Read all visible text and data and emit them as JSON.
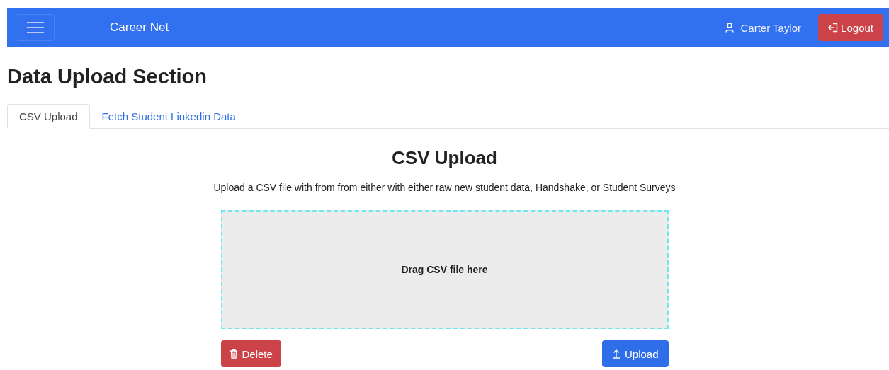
{
  "navbar": {
    "brand": "Career Net",
    "user": "Carter Taylor",
    "logout": "Logout"
  },
  "heading": "Data Upload Section",
  "tabs": [
    {
      "label": "CSV Upload",
      "selected": true
    },
    {
      "label": "Fetch Student Linkedin Data",
      "selected": false
    }
  ],
  "panel": {
    "title": "CSV Upload",
    "description": "Upload a CSV file with from from either with either raw new student data, Handshake, or Student Surveys",
    "dropzone": "Drag CSV file here",
    "delete": "Delete",
    "upload": "Upload"
  }
}
